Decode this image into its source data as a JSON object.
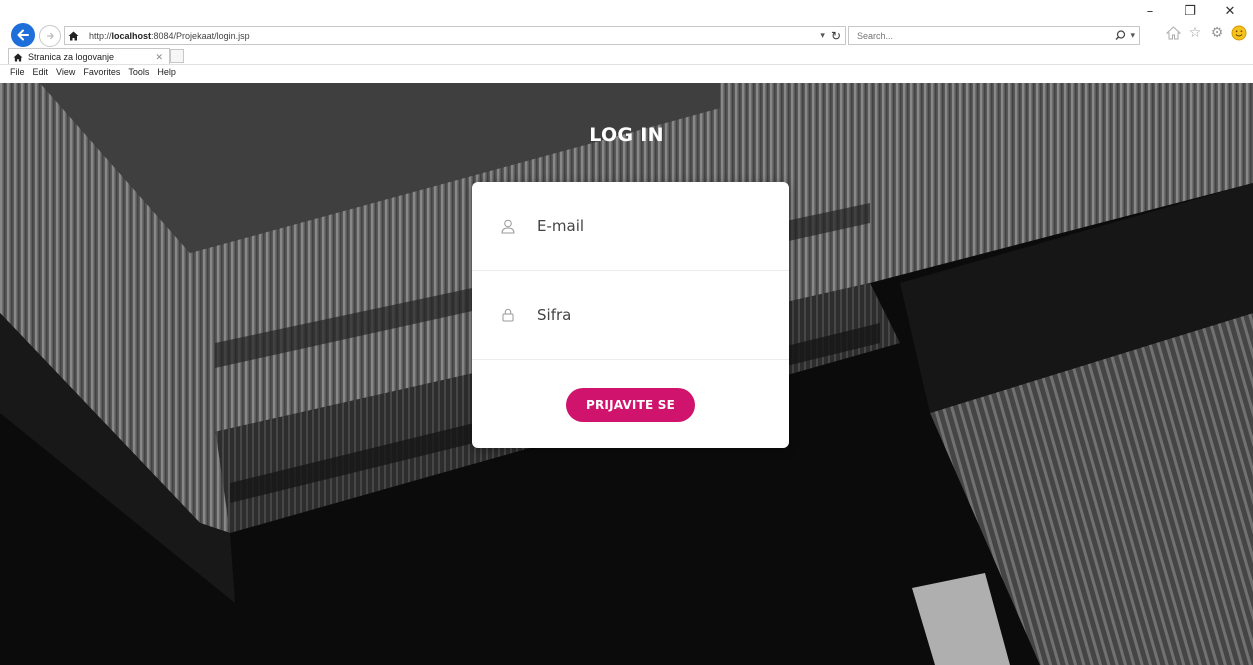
{
  "browser": {
    "url_prefix": "http://",
    "url_host": "localhost",
    "url_path": ":8084/Projekaat/login.jsp",
    "search_placeholder": "Search...",
    "tab_title": "Stranica za logovanje",
    "menu": [
      "File",
      "Edit",
      "View",
      "Favorites",
      "Tools",
      "Help"
    ]
  },
  "page": {
    "title": "LOG IN",
    "email_placeholder": "E-mail",
    "password_placeholder": "Sifra",
    "submit_label": "PRIJAVITE SE"
  },
  "colors": {
    "accent": "#d0136c",
    "card": "#ffffff",
    "back_button": "#1e6fd9"
  },
  "icons": {
    "email_field": "user-icon",
    "password_field": "lock-icon"
  }
}
